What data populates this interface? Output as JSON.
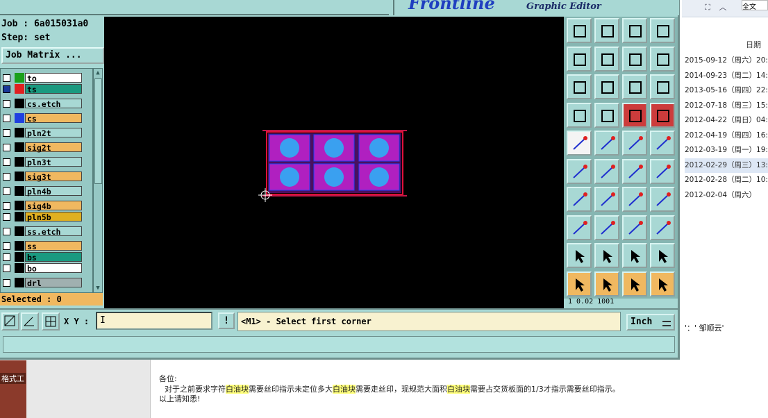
{
  "app": {
    "logo_text": "Frontline",
    "subtitle": "Graphic Editor",
    "job_label": "Job : 6a015031a0",
    "step_label": "Step: set",
    "job_matrix_button": "Job Matrix ...",
    "selected_status": "Selected : 0"
  },
  "layers": [
    {
      "name": "to",
      "swatch": "#1aa01a",
      "fill": "#ffffff"
    },
    {
      "name": "ts",
      "swatch": "#e02020",
      "fill": "#1a9a80",
      "active": true
    },
    {
      "name": "cs.etch",
      "swatch": "#000000",
      "fill": "#a8d8d4"
    },
    {
      "name": "cs",
      "swatch": "#2040e0",
      "fill": "#f0b860"
    },
    {
      "name": "pln2t",
      "swatch": "#000000",
      "fill": "#a8d8d4"
    },
    {
      "name": "sig2t",
      "swatch": "#000000",
      "fill": "#f0b860"
    },
    {
      "name": "pln3t",
      "swatch": "#000000",
      "fill": "#a8d8d4"
    },
    {
      "name": "sig3t",
      "swatch": "#000000",
      "fill": "#f0b860"
    },
    {
      "name": "pln4b",
      "swatch": "#000000",
      "fill": "#a8d8d4"
    },
    {
      "name": "sig4b",
      "swatch": "#000000",
      "fill": "#f0b860"
    },
    {
      "name": "pln5b",
      "swatch": "#000000",
      "fill": "#e0b020"
    },
    {
      "name": "ss.etch",
      "swatch": "#000000",
      "fill": "#a8d8d4"
    },
    {
      "name": "ss",
      "swatch": "#000000",
      "fill": "#f0b860"
    },
    {
      "name": "bs",
      "swatch": "#000000",
      "fill": "#1a9a80"
    },
    {
      "name": "bo",
      "swatch": "#000000",
      "fill": "#ffffff"
    },
    {
      "name": "drl",
      "swatch": "#000000",
      "fill": "#a0b0b0"
    }
  ],
  "bottom": {
    "xy_label": "X Y :",
    "xy_value": "I",
    "bang_label": "!",
    "message": "<M1> - Select first corner",
    "units": "Inch"
  },
  "tool_readout": "1  0.02 1001",
  "background_window": {
    "search_text": "全文",
    "date_header": "日期",
    "rows": [
      "2015-09-12（周六）20:",
      "2014-09-23（周二）14:",
      "2013-05-16（周四）22:",
      "2012-07-18（周三）15:",
      "2012-04-22（周日）04:",
      "2012-04-19（周四）16:",
      "2012-03-19（周一）19:",
      "2012-02-29（周三）13:",
      "2012-02-28（周二）10:",
      "2012-02-04（周六）"
    ],
    "selected_row": 7,
    "quote": "'：' 邹顺云'"
  },
  "email": {
    "greeting": "各位:",
    "body_1": "对于之前要求字符",
    "hl_1": "白油块",
    "body_2": "需要丝印指示未定位多大",
    "hl_2": "白油块",
    "body_3": "需要走丝印，现规范大面积",
    "hl_3": "白油块",
    "body_4": "需要占交货板面的1/3才指示需要丝印指示。",
    "closing": "以上请知悉!",
    "left_label": "格式工"
  }
}
